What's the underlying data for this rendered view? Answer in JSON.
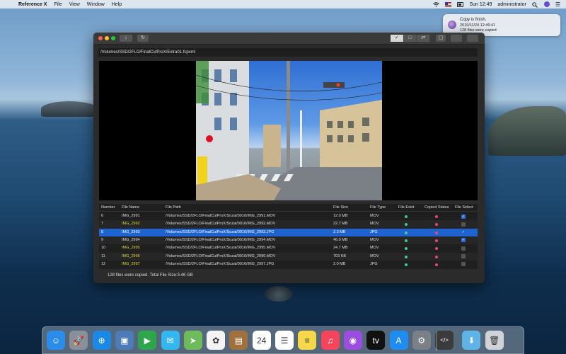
{
  "menubar": {
    "app_name": "Reference X",
    "menus": [
      "File",
      "View",
      "Window",
      "Help"
    ],
    "clock": "Sun 12:49",
    "user": "administrator"
  },
  "notification": {
    "title": "Copy is finish.",
    "timestamp": "2019/11/24 12:49:41",
    "message": "128 files were copied"
  },
  "window": {
    "path": "/Volumes/SSD/2FLO/FinalCutProX/Extra01.fcpxml",
    "toolbar": {
      "download_icon": "↓",
      "refresh_icon": "↻",
      "view_modes": [
        "✓",
        "□",
        "⇄"
      ]
    },
    "table": {
      "headers": {
        "number": "Number",
        "name": "File Name",
        "path": "File Path",
        "size": "File Size",
        "type": "File Type",
        "exist": "File Exist",
        "status": "Copied Status",
        "select": "File Select"
      },
      "rows": [
        {
          "number": "6",
          "name": "IMG_2991",
          "path": "/Volumes/SSD/2FLO/FinalCutProX/Sozai/0916/IMG_2991.MOV",
          "size": "12.0 MB",
          "type": "MOV",
          "highlight": false,
          "selected": false,
          "checked": true
        },
        {
          "number": "7",
          "name": "IMG_2992",
          "path": "/Volumes/SSD/2FLO/FinalCutProX/Sozai/0916/IMG_2992.MOV",
          "size": "22.7 MB",
          "type": "MOV",
          "highlight": true,
          "selected": false,
          "checked": false
        },
        {
          "number": "8",
          "name": "IMG_2993",
          "path": "/Volumes/SSD/2FLO/FinalCutProX/Sozai/0916/IMG_2993.JPG",
          "size": "2.3 MB",
          "type": "JPG",
          "highlight": false,
          "selected": true,
          "checked": true
        },
        {
          "number": "9",
          "name": "IMG_2994",
          "path": "/Volumes/SSD/2FLO/FinalCutProX/Sozai/0916/IMG_2994.MOV",
          "size": "46.0 MB",
          "type": "MOV",
          "highlight": false,
          "selected": false,
          "checked": true
        },
        {
          "number": "10",
          "name": "IMG_2995",
          "path": "/Volumes/SSD/2FLO/FinalCutProX/Sozai/0916/IMG_2995.MOV",
          "size": "24.7 MB",
          "type": "MOV",
          "highlight": true,
          "selected": false,
          "checked": false
        },
        {
          "number": "11",
          "name": "IMG_2996",
          "path": "/Volumes/SSD/2FLO/FinalCutProX/Sozai/0916/IMG_2996.MOV",
          "size": "703 KB",
          "type": "MOV",
          "highlight": true,
          "selected": false,
          "checked": false
        },
        {
          "number": "12",
          "name": "IMG_2997",
          "path": "/Volumes/SSD/2FLO/FinalCutProX/Sozai/0916/IMG_2997.JPG",
          "size": "2.0 MB",
          "type": "JPG",
          "highlight": true,
          "selected": false,
          "checked": false
        }
      ]
    },
    "status": "128 files were copied.   Total File Size:3.46 GB"
  },
  "colors": {
    "exist_dot": "#3ccf8e",
    "status_dot": "#e9467f",
    "selection": "#1e63d0",
    "highlight_name": "#e3d43b"
  },
  "dock": {
    "apps": [
      {
        "name": "finder-icon",
        "color": "#2b8de8",
        "glyph": "☺"
      },
      {
        "name": "launchpad-icon",
        "color": "#8a8f98",
        "glyph": "🚀"
      },
      {
        "name": "safari-icon",
        "color": "#1b88e6",
        "glyph": "⊕"
      },
      {
        "name": "preview-icon",
        "color": "#4b7cb8",
        "glyph": "▣"
      },
      {
        "name": "facetime-icon",
        "color": "#2ea64c",
        "glyph": "▶"
      },
      {
        "name": "messages-icon",
        "color": "#34b7f1",
        "glyph": "✉"
      },
      {
        "name": "maps-icon",
        "color": "#6dbb5a",
        "glyph": "➤"
      },
      {
        "name": "photos-icon",
        "color": "#f4f4f4",
        "glyph": "✿"
      },
      {
        "name": "notes-book-icon",
        "color": "#a0713d",
        "glyph": "▤"
      },
      {
        "name": "calendar-icon",
        "color": "#ffffff",
        "glyph": "24"
      },
      {
        "name": "reminders-icon",
        "color": "#ffffff",
        "glyph": "☰"
      },
      {
        "name": "notes-icon",
        "color": "#f7d84a",
        "glyph": "≡"
      },
      {
        "name": "music-icon",
        "color": "#f5455c",
        "glyph": "♫"
      },
      {
        "name": "podcasts-icon",
        "color": "#9b4de0",
        "glyph": "◉"
      },
      {
        "name": "appletv-icon",
        "color": "#111111",
        "glyph": "tv"
      },
      {
        "name": "appstore-icon",
        "color": "#1e8cf0",
        "glyph": "A"
      },
      {
        "name": "system-preferences-icon",
        "color": "#7b7f86",
        "glyph": "⚙"
      },
      {
        "name": "script-editor-icon",
        "color": "#3b3b3b",
        "glyph": "</>"
      },
      {
        "name": "downloads-folder-icon",
        "color": "#5fb3e6",
        "glyph": "⬇"
      },
      {
        "name": "trash-icon",
        "color": "#cfd3d8",
        "glyph": "🗑"
      }
    ]
  }
}
